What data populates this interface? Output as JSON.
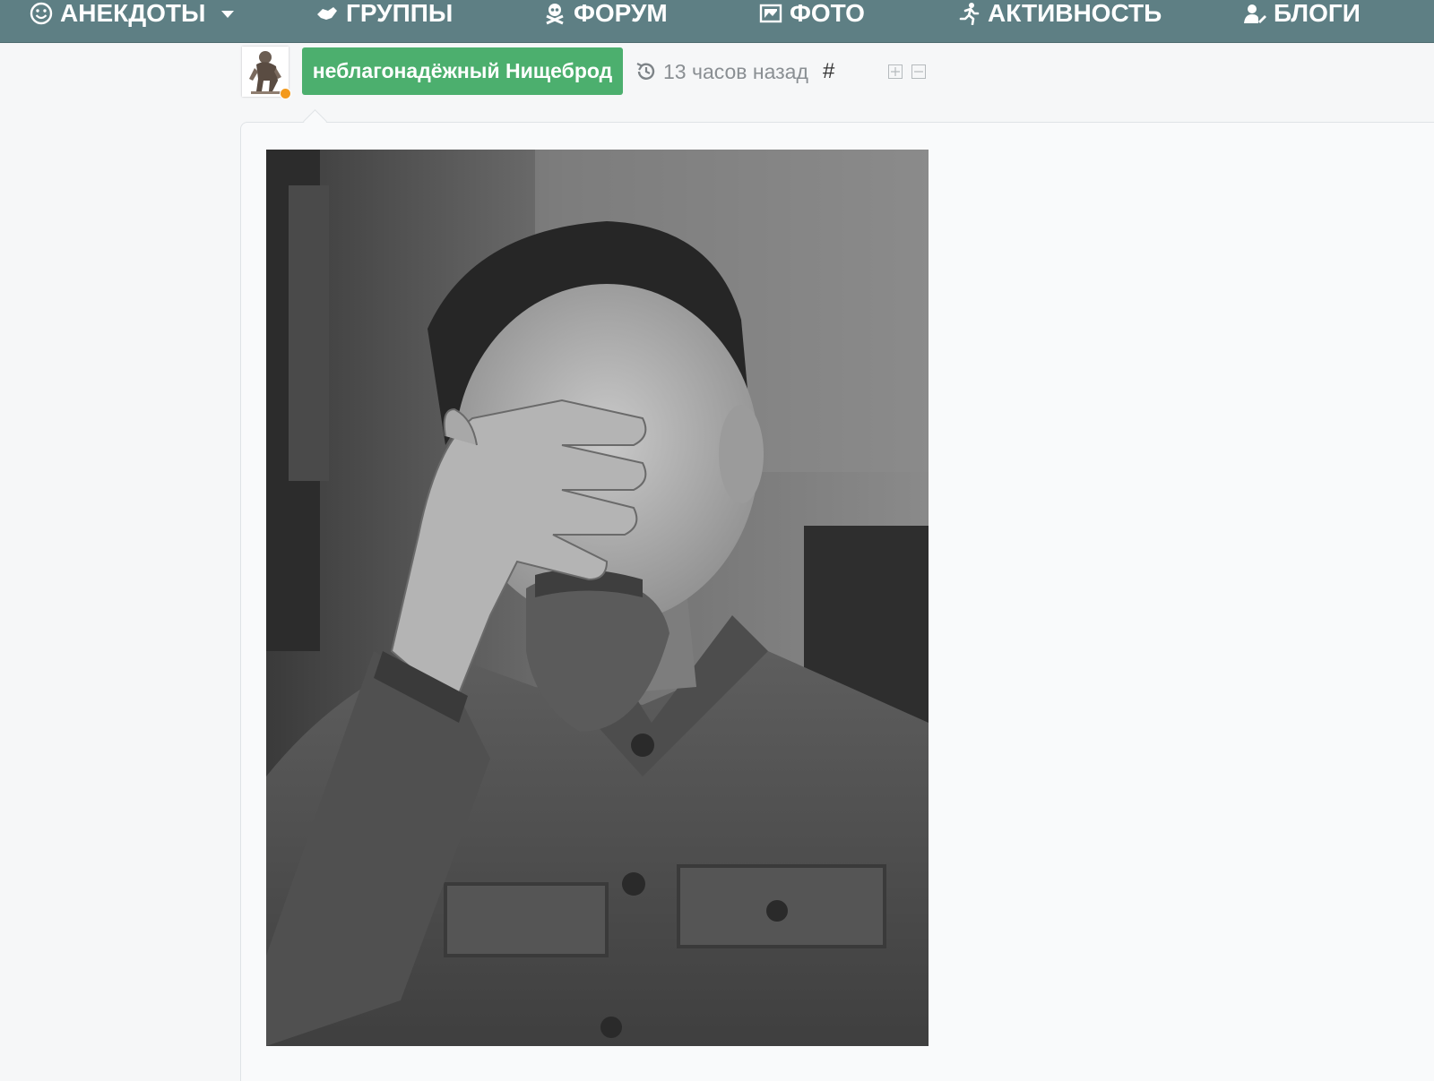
{
  "nav": {
    "items": [
      {
        "label": "АНЕКДОТЫ",
        "icon": "smiley-icon"
      },
      {
        "label": "ГРУППЫ",
        "icon": "handshake-icon"
      },
      {
        "label": "ФОРУМ",
        "icon": "skull-crossbones-icon"
      },
      {
        "label": "ФОТО",
        "icon": "photo-icon"
      },
      {
        "label": "АКТИВНОСТЬ",
        "icon": "running-man-icon"
      },
      {
        "label": "БЛОГИ",
        "icon": "user-edit-icon"
      }
    ],
    "background": "#5e7f84"
  },
  "post": {
    "author": "неблагонадёжный Нищеброд",
    "author_color": "#4caf6e",
    "time": "13 часов назад",
    "permalink": "#",
    "status_color": "#f39a1d"
  }
}
